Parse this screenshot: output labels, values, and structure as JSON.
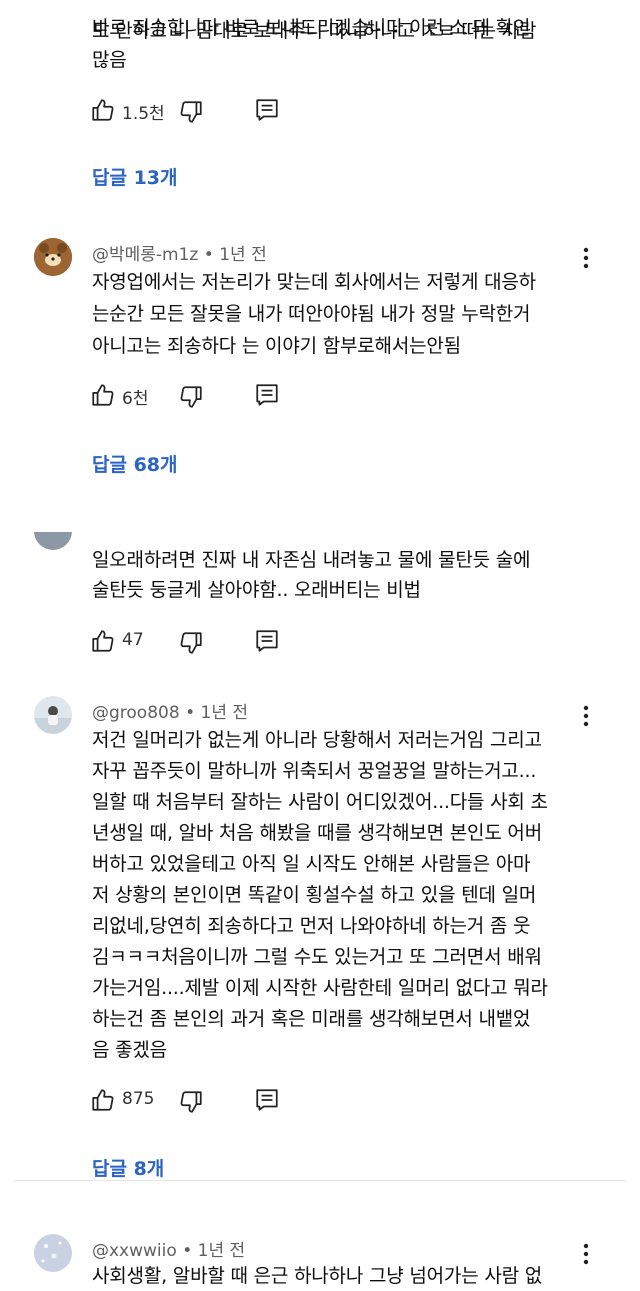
{
  "comments": [
    {
      "id": "c0",
      "text_lines": [
        "바로 죄송합니다 바로 보내드리겠습니다 이런 소 돼 확인",
        "도 안하고 니 맘대로 보내주니 마니하냐고 ㅈㄹ 떠는 사람",
        "많음"
      ],
      "likes": "1.5천",
      "replies_label": "답글 13개"
    },
    {
      "id": "c1",
      "author": "@박메롱-m1z",
      "time": "1년 전",
      "text_lines": [
        "자영업에서는 저논리가 맞는데 회사에서는 저렇게 대응하",
        "는순간  모든 잘못을 내가 떠안아야됨 내가 정말 누락한거",
        "아니고는 죄송하다 는 이야기 함부로해서는안됨"
      ],
      "likes": "6천",
      "replies_label": "답글 68개"
    },
    {
      "id": "c2",
      "text_lines": [
        "일오래하려면 진짜 내 자존심 내려놓고 물에 물탄듯 술에",
        "술탄듯 둥글게 살아야함.. 오래버티는 비법"
      ],
      "likes": "47"
    },
    {
      "id": "c3",
      "author": "@groo808",
      "time": "1년 전",
      "text_lines": [
        "저건 일머리가 없는게 아니라 당황해서 저러는거임 그리고",
        "자꾸 꼽주듯이 말하니까 위축되서 꿍얼꿍얼 말하는거고...",
        "일할 때 처음부터 잘하는 사람이 어디있겠어...다들 사회 초",
        "년생일 때, 알바 처음 해봤을 때를 생각해보면 본인도 어버",
        "버하고 있었을테고 아직 일 시작도 안해본 사람들은 아마",
        "저 상황의 본인이면 똑같이 횡설수설 하고 있을 텐데 일머",
        "리없네,당연히 죄송하다고 먼저 나와야하네 하는거 좀 웃",
        "김ㅋㅋㅋ처음이니까 그럴 수도 있는거고 또 그러면서 배워",
        "가는거임....제발 이제 시작한 사람한테 일머리 없다고 뭐라",
        "하는건 좀 본인의 과거 혹은 미래를 생각해보면서 내뱉었",
        "음 좋겠음"
      ],
      "likes": "875",
      "replies_label": "답글 8개"
    },
    {
      "id": "c4",
      "author": "@xxwwiio",
      "time": "1년 전",
      "text_lines": [
        "사회생활, 알바할 때 은근 하나하나 그냥 넘어가는 사람 없"
      ]
    }
  ],
  "icons": {
    "like": "thumbs-up-icon",
    "dislike": "thumbs-down-icon",
    "reply": "comment-reply-icon",
    "more": "more-vertical-icon"
  },
  "colors": {
    "replies_link": "#2b64c5",
    "meta": "#606060",
    "text": "#0f0f0f"
  }
}
